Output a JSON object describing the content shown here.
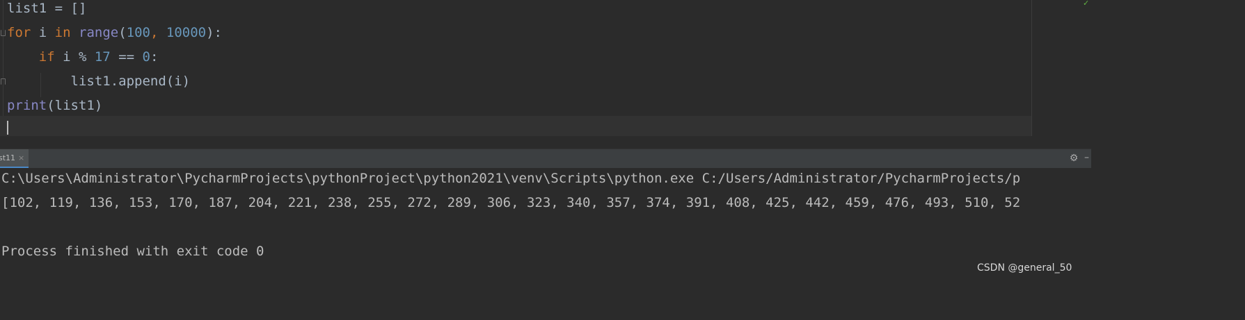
{
  "editor": {
    "lines": [
      {
        "segments": [
          {
            "text": "list1 = []",
            "cls": ""
          }
        ]
      },
      {
        "segments": [
          {
            "text": "for",
            "cls": "kw"
          },
          {
            "text": " i ",
            "cls": ""
          },
          {
            "text": "in",
            "cls": "kw"
          },
          {
            "text": " ",
            "cls": ""
          },
          {
            "text": "range",
            "cls": "bi"
          },
          {
            "text": "(",
            "cls": ""
          },
          {
            "text": "100",
            "cls": "num"
          },
          {
            "text": ", ",
            "cls": "kw"
          },
          {
            "text": "10000",
            "cls": "num"
          },
          {
            "text": "):",
            "cls": ""
          }
        ]
      },
      {
        "segments": [
          {
            "text": "    ",
            "cls": ""
          },
          {
            "text": "if",
            "cls": "kw"
          },
          {
            "text": " i % ",
            "cls": ""
          },
          {
            "text": "17",
            "cls": "num"
          },
          {
            "text": " == ",
            "cls": ""
          },
          {
            "text": "0",
            "cls": "num"
          },
          {
            "text": ":",
            "cls": ""
          }
        ]
      },
      {
        "segments": [
          {
            "text": "        list1.append(i)",
            "cls": ""
          }
        ]
      },
      {
        "segments": [
          {
            "text": "print",
            "cls": "bi"
          },
          {
            "text": "(list1)",
            "cls": ""
          }
        ]
      },
      {
        "segments": [
          {
            "text": "",
            "cls": ""
          }
        ]
      }
    ]
  },
  "run_panel": {
    "tab_label": "st11",
    "close_glyph": "×",
    "settings_glyph": "⚙",
    "minimize_glyph": "–",
    "console_lines": [
      "C:\\Users\\Administrator\\PycharmProjects\\pythonProject\\python2021\\venv\\Scripts\\python.exe C:/Users/Administrator/PycharmProjects/p",
      "[102, 119, 136, 153, 170, 187, 204, 221, 238, 255, 272, 289, 306, 323, 340, 357, 374, 391, 408, 425, 442, 459, 476, 493, 510, 52",
      "",
      "Process finished with exit code 0"
    ]
  },
  "watermark": "CSDN @general_50",
  "icons": {
    "inspection": "check-icon",
    "settings": "gear-icon",
    "minimize": "minimize-icon",
    "close": "close-icon"
  },
  "colors": {
    "background": "#2b2b2b",
    "keyword": "#cc7832",
    "number": "#6897bb",
    "builtin": "#8888c6",
    "text": "#a9b7c6",
    "console_text": "#bbbbbb",
    "inspection_ok": "#62b543"
  }
}
